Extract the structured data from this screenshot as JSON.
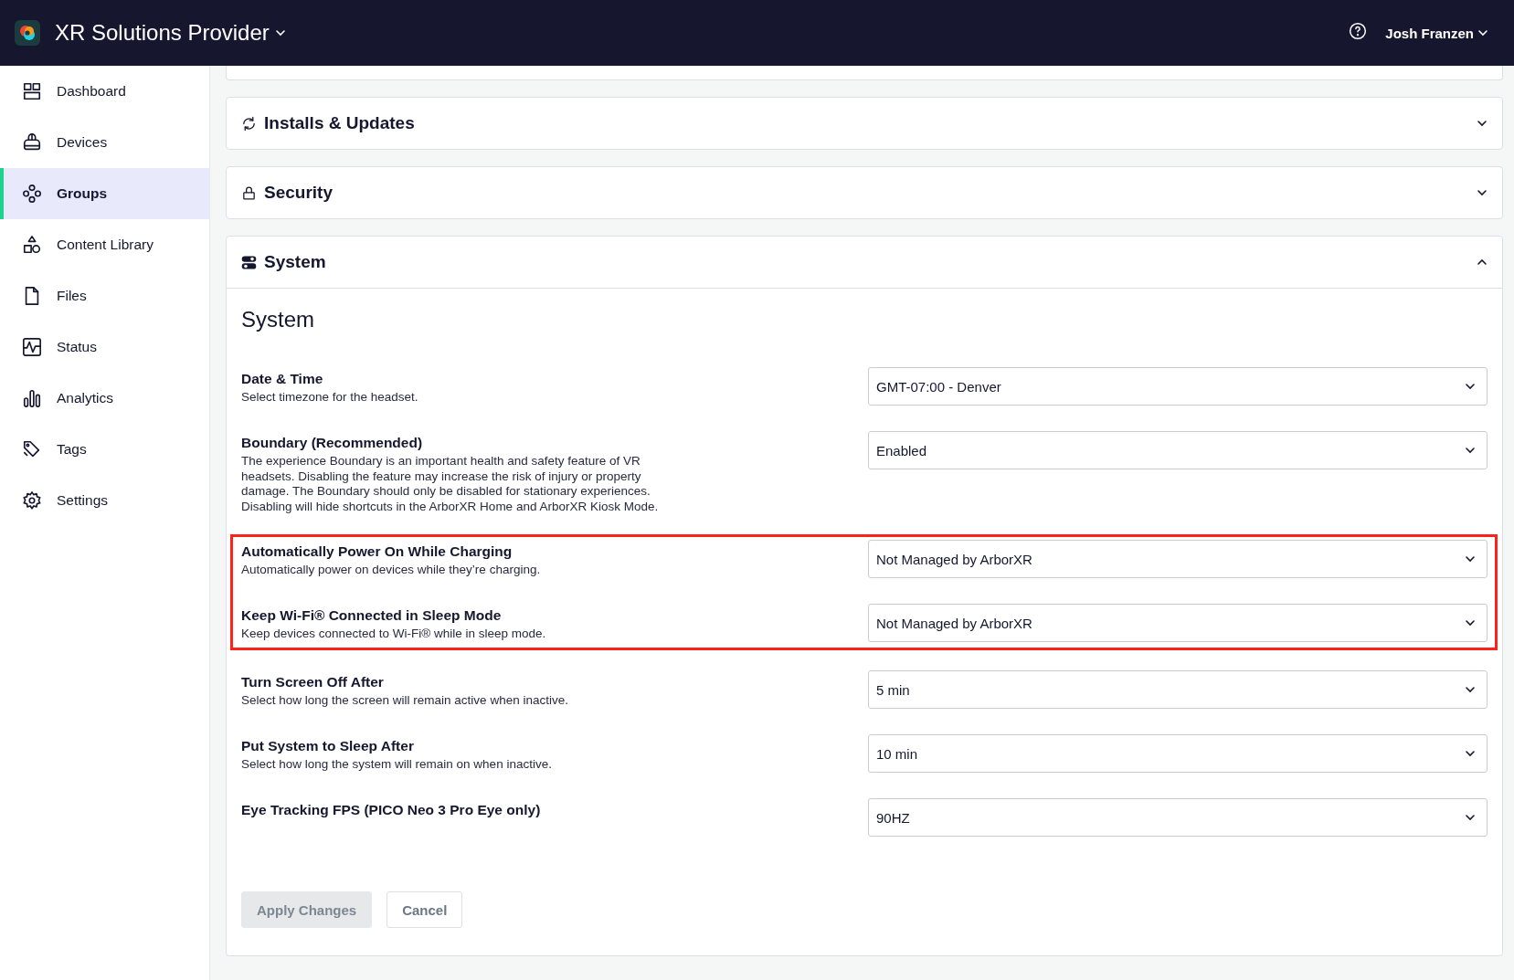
{
  "header": {
    "org_name": "XR Solutions Provider",
    "user_name": "Josh Franzen"
  },
  "sidebar": {
    "items": [
      {
        "label": "Dashboard",
        "selected": false
      },
      {
        "label": "Devices",
        "selected": false
      },
      {
        "label": "Groups",
        "selected": true
      },
      {
        "label": "Content Library",
        "selected": false
      },
      {
        "label": "Files",
        "selected": false
      },
      {
        "label": "Status",
        "selected": false
      },
      {
        "label": "Analytics",
        "selected": false
      },
      {
        "label": "Tags",
        "selected": false
      },
      {
        "label": "Settings",
        "selected": false
      }
    ]
  },
  "sections": [
    {
      "title": "Installs & Updates",
      "expanded": false
    },
    {
      "title": "Security",
      "expanded": false
    },
    {
      "title": "System",
      "expanded": true
    }
  ],
  "system": {
    "heading": "System",
    "settings": [
      {
        "title": "Date & Time",
        "description": "Select timezone for the headset.",
        "value": "GMT-07:00 - Denver",
        "highlighted": false
      },
      {
        "title": "Boundary (Recommended)",
        "description": "The experience Boundary is an important health and safety feature of VR headsets. Disabling the feature may increase the risk of injury or property damage. The Boundary should only be disabled for stationary experiences. Disabling will hide shortcuts in the ArborXR Home and ArborXR Kiosk Mode.",
        "value": "Enabled",
        "highlighted": false
      },
      {
        "title": "Automatically Power On While Charging",
        "description": "Automatically power on devices while they’re charging.",
        "value": "Not Managed by ArborXR",
        "highlighted": true
      },
      {
        "title": "Keep Wi-Fi® Connected in Sleep Mode",
        "description": "Keep devices connected to Wi-Fi® while in sleep mode.",
        "value": "Not Managed by ArborXR",
        "highlighted": true
      },
      {
        "title": "Turn Screen Off After",
        "description": "Select how long the screen will remain active when inactive.",
        "value": "5 min",
        "highlighted": false
      },
      {
        "title": "Put System to Sleep After",
        "description": "Select how long the system will remain on when inactive.",
        "value": "10 min",
        "highlighted": false
      },
      {
        "title": "Eye Tracking FPS (PICO Neo 3 Pro Eye only)",
        "value": "90HZ",
        "highlighted": false
      }
    ],
    "buttons": [
      {
        "label": "Apply Changes",
        "disabled": true
      },
      {
        "label": "Cancel",
        "disabled": false
      }
    ]
  }
}
